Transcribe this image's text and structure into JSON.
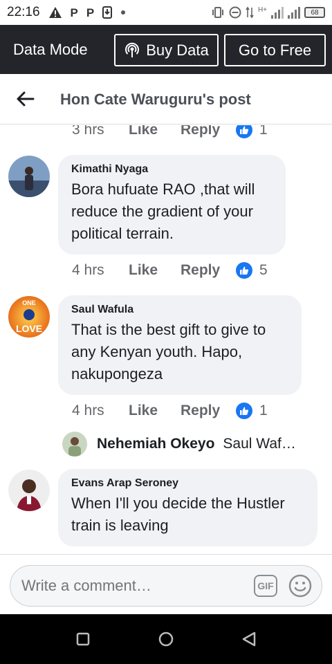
{
  "status_bar": {
    "time": "22:16",
    "left_icons": [
      "warning-icon",
      "p-icon",
      "p-icon",
      "download-icon",
      "dot-icon"
    ],
    "left_glyphs": [
      "P",
      "P"
    ],
    "network_label": "H+",
    "battery": "68"
  },
  "data_bar": {
    "title": "Data Mode",
    "buy_label": "Buy Data",
    "free_label": "Go to Free"
  },
  "header": {
    "title": "Hon Cate Waruguru's post"
  },
  "top_meta": {
    "time": "3 hrs",
    "like": "Like",
    "reply": "Reply",
    "reactions": "1"
  },
  "comments": [
    {
      "author": "Kimathi Nyaga",
      "text": "Bora hufuate RAO ,that will reduce the gradient of your political terrain.",
      "time": "4 hrs",
      "like": "Like",
      "reply": "Reply",
      "reactions": "5"
    },
    {
      "author": "Saul Wafula",
      "text": "That is the best gift to give to any Kenyan youth. Hapo, nakupongeza",
      "time": "4 hrs",
      "like": "Like",
      "reply": "Reply",
      "reactions": "1",
      "avatar_text_top": "ONE",
      "avatar_text_bottom": "LOVE"
    },
    {
      "author": "Evans Arap Seroney",
      "text": "When I'll you decide the Hustler train is leaving"
    }
  ],
  "reply_preview": {
    "name": "Nehemiah Okeyo",
    "snippet": "Saul Waf…"
  },
  "composer": {
    "placeholder": "Write a comment…",
    "gif_label": "GIF"
  },
  "colors": {
    "data_bar_bg": "#23252a",
    "like_blue": "#1877f2",
    "bubble_bg": "#f0f2f5",
    "meta_gray": "#65676b"
  }
}
